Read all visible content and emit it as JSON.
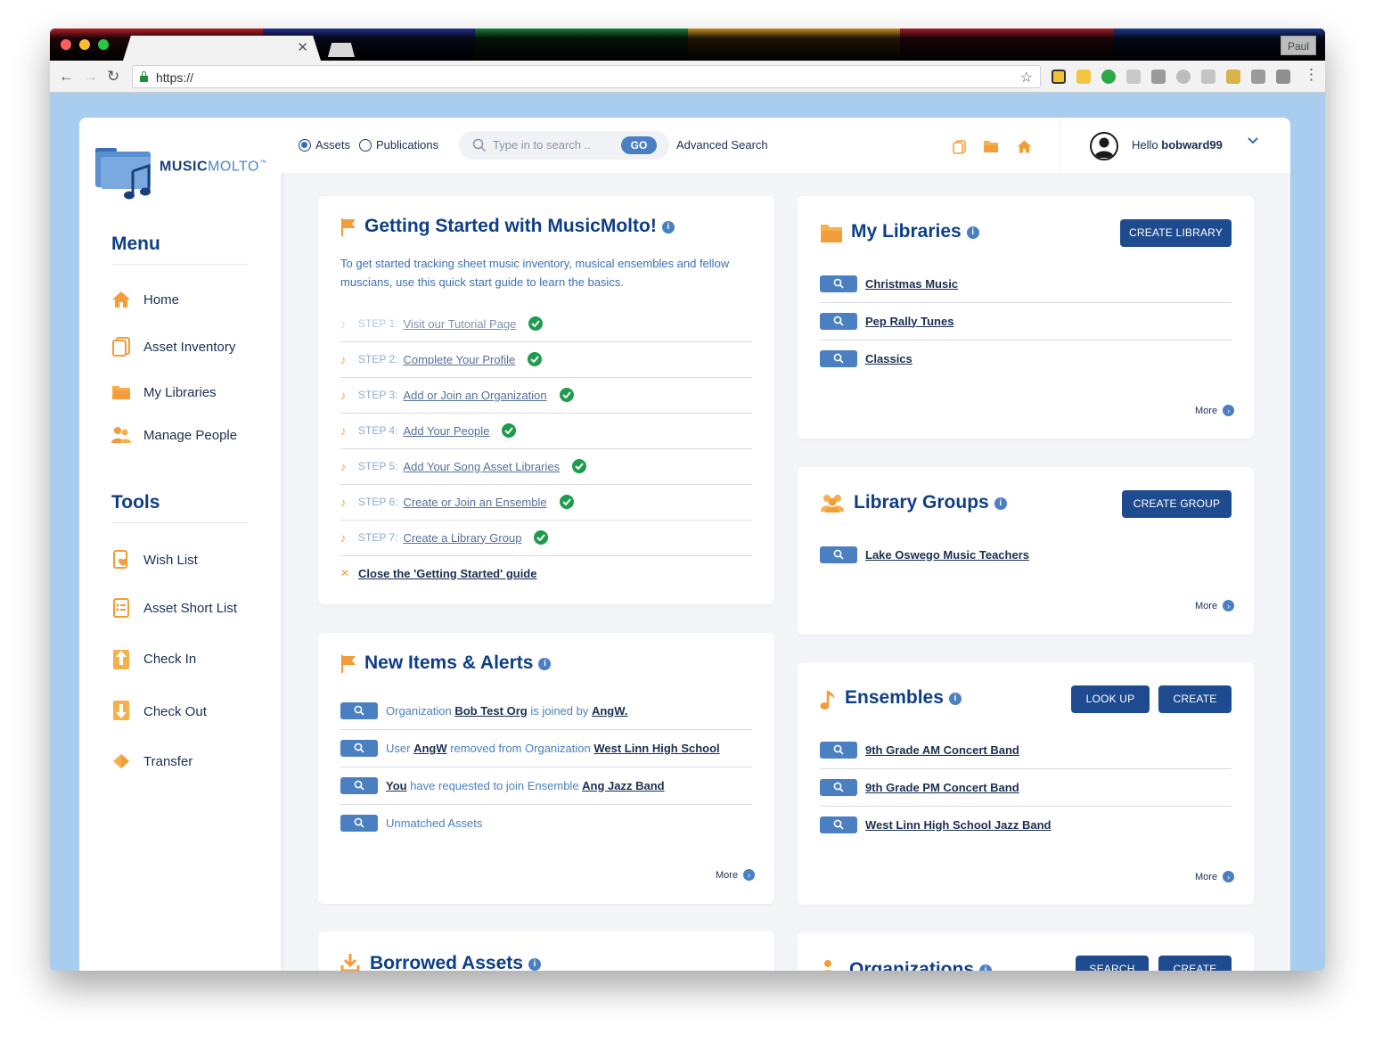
{
  "browser": {
    "url": "https://",
    "user_chip": "Paul",
    "stripe_colors": [
      "#b3202a",
      "#1f2f8c",
      "#1e7a3a",
      "#c08c22",
      "#a01e2b",
      "#1e3a8e"
    ]
  },
  "logo": {
    "brand_bold": "MUSIC",
    "brand_light": "MOLTO",
    "tm": "™"
  },
  "sidebar": {
    "menu_title": "Menu",
    "menu_items": [
      {
        "label": "Home",
        "icon": "home-icon"
      },
      {
        "label": "Asset Inventory",
        "icon": "inventory-icon"
      },
      {
        "label": "My Libraries",
        "icon": "folder-icon"
      },
      {
        "label": "Manage People",
        "icon": "people-icon"
      }
    ],
    "tools_title": "Tools",
    "tool_items": [
      {
        "label": "Wish List",
        "icon": "wish-list-icon"
      },
      {
        "label": "Asset Short List",
        "icon": "short-list-icon"
      },
      {
        "label": "Check In",
        "icon": "check-in-icon"
      },
      {
        "label": "Check Out",
        "icon": "check-out-icon"
      },
      {
        "label": "Transfer",
        "icon": "transfer-icon"
      }
    ]
  },
  "topbar": {
    "radio_assets": "Assets",
    "radio_publications": "Publications",
    "search_placeholder": "Type in to search ..",
    "go_label": "GO",
    "advanced_search": "Advanced Search",
    "hello_prefix": "Hello ",
    "username": "bobward99"
  },
  "getting_started": {
    "title": "Getting Started with MusicMolto!",
    "intro": "To get started tracking sheet music inventory, musical ensembles and fellow muscians, use this quick start guide to learn the basics.",
    "steps": [
      {
        "label": "STEP 1:",
        "text": "Visit our Tutorial Page"
      },
      {
        "label": "STEP 2:",
        "text": "Complete Your Profile"
      },
      {
        "label": "STEP 3:",
        "text": "Add or Join an Organization"
      },
      {
        "label": "STEP 4:",
        "text": "Add Your People"
      },
      {
        "label": "STEP 5:",
        "text": "Add Your Song Asset Libraries"
      },
      {
        "label": "STEP 6:",
        "text": "Create or Join an Ensemble"
      },
      {
        "label": "STEP 7:",
        "text": "Create a Library Group"
      }
    ],
    "close_link": "Close the 'Getting Started' guide"
  },
  "alerts": {
    "title": "New Items & Alerts",
    "rows": [
      {
        "a": "Organization ",
        "b": "Bob Test Org",
        "c": " is joined by ",
        "d": "AngW.",
        "e": ""
      },
      {
        "a": "User ",
        "b": "AngW",
        "c": " removed from Organization ",
        "d": "West Linn High School",
        "e": ""
      },
      {
        "a": "",
        "b": "You",
        "c": " have requested to join Ensemble ",
        "d": "Ang Jazz Band",
        "e": ""
      },
      {
        "a": "Unmatched Assets",
        "b": "",
        "c": "",
        "d": "",
        "e": ""
      }
    ],
    "more": "More"
  },
  "borrowed": {
    "title": "Borrowed Assets"
  },
  "libraries": {
    "title": "My Libraries",
    "button": "CREATE LIBRARY",
    "items": [
      "Christmas Music",
      "Pep Rally Tunes",
      "Classics"
    ],
    "more": "More"
  },
  "groups": {
    "title": "Library Groups",
    "button": "CREATE GROUP",
    "items": [
      "Lake Oswego Music Teachers"
    ],
    "more": "More"
  },
  "ensembles": {
    "title": "Ensembles",
    "button_lookup": "LOOK UP",
    "button_create": "CREATE",
    "items": [
      "9th Grade AM Concert Band",
      "9th Grade PM Concert Band",
      "West Linn High School Jazz Band"
    ],
    "more": "More"
  },
  "organizations": {
    "title": "Organizations",
    "button_search": "SEARCH",
    "button_create": "CREATE"
  }
}
